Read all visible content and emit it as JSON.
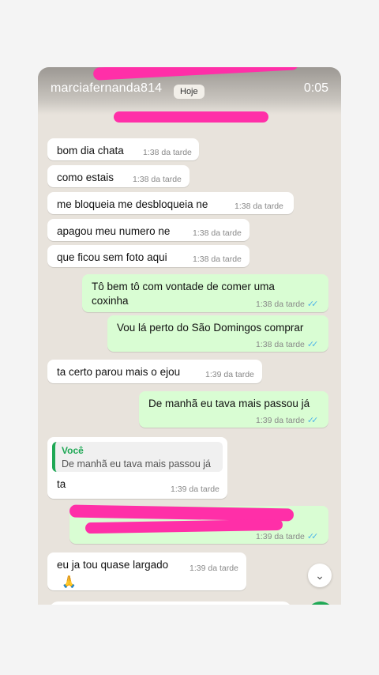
{
  "header": {
    "username": "marciafernanda814",
    "timer": "0:05",
    "date_chip": "Hoje"
  },
  "messages": [
    {
      "text": "bom dia chata",
      "time": "1:38 da tarde"
    },
    {
      "text": "como estais",
      "time": "1:38 da tarde"
    },
    {
      "text": "me bloqueia me desbloqueia ne",
      "time": "1:38 da tarde"
    },
    {
      "text": "apagou meu numero ne",
      "time": "1:38 da tarde"
    },
    {
      "text": "que ficou sem foto aqui",
      "time": "1:38 da tarde"
    },
    {
      "line1": "Tô bem tô com vontade de comer uma",
      "line2": "coxinha",
      "time": "1:38 da tarde"
    },
    {
      "text": "Vou lá perto do São Domingos comprar",
      "time": "1:38 da tarde"
    },
    {
      "text": "ta certo parou mais o ejou",
      "time": "1:39 da tarde"
    },
    {
      "text": "De manhã eu tava mais passou já",
      "time": "1:39 da tarde"
    },
    {
      "reply_name": "Você",
      "reply_text": "De manhã eu tava mais passou já",
      "text": "ta",
      "time": "1:39 da tarde"
    },
    {
      "text": "",
      "time": "1:39 da tarde"
    },
    {
      "text": "eu ja tou quase largado",
      "time": "1:39 da tarde"
    }
  ],
  "emoji": "🙏",
  "icons": {
    "double_check": "✓✓",
    "scroll_down": "⌄"
  },
  "colors": {
    "outgoing": "#d9fdd3",
    "incoming": "#ffffff",
    "accent": "#1fa855",
    "read_tick": "#4fb5e8"
  }
}
